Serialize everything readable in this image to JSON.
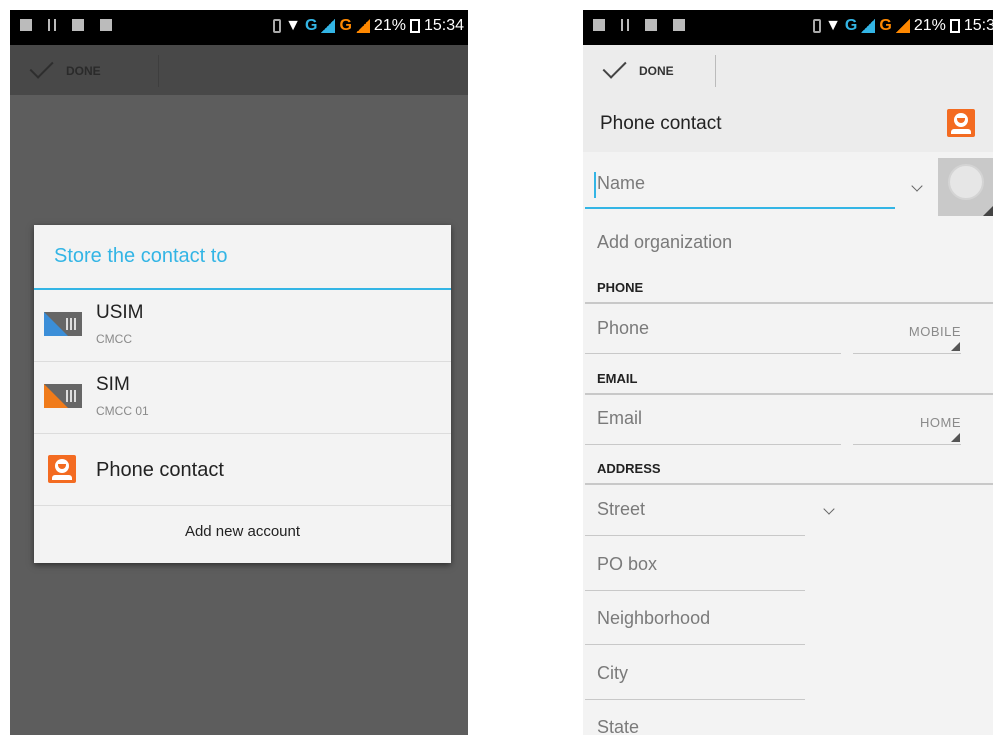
{
  "status_bar": {
    "time_left": "15:34",
    "time_right": "15:3",
    "battery": "21%",
    "network_1": "G",
    "network_2": "G"
  },
  "action_bar": {
    "done_label": "DONE"
  },
  "dialog": {
    "title": "Store the contact to",
    "accounts": [
      {
        "name": "USIM",
        "sub": "CMCC",
        "icon": "usim-card-icon"
      },
      {
        "name": "SIM",
        "sub": "CMCC 01",
        "icon": "sim-card-icon"
      },
      {
        "name": "Phone contact",
        "sub": "",
        "icon": "person-icon"
      }
    ],
    "add_new": "Add new account"
  },
  "form": {
    "header_title": "Phone contact",
    "name_placeholder": "Name",
    "add_org": "Add organization",
    "phone_header": "PHONE",
    "phone_placeholder": "Phone",
    "phone_type": "MOBILE",
    "email_header": "EMAIL",
    "email_placeholder": "Email",
    "email_type": "HOME",
    "address_header": "ADDRESS",
    "address_fields": [
      "Street",
      "PO box",
      "Neighborhood",
      "City",
      "State"
    ]
  },
  "colors": {
    "accent": "#33b5e5",
    "contact_orange": "#f36b21",
    "sim_blue": "#3b8ed8",
    "sim_orange": "#f07b1a"
  }
}
